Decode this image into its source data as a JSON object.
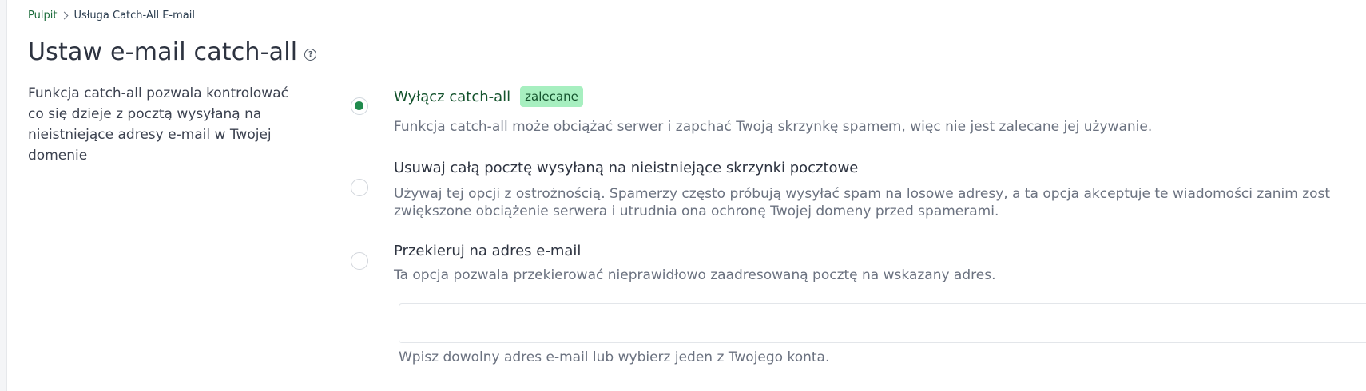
{
  "breadcrumb": {
    "home": "Pulpit",
    "current": "Usługa Catch-All E-mail"
  },
  "page": {
    "title": "Ustaw e-mail catch-all",
    "help_glyph": "?"
  },
  "description": "Funkcja catch-all pozwala kontrolować co się dzieje z pocztą wysyłaną na nieistniejące adresy e-mail w Twojej domenie",
  "options": [
    {
      "label": "Wyłącz catch-all",
      "badge": "zalecane",
      "description": "Funkcja catch-all może obciążać serwer i zapchać Twoją skrzynkę spamem, więc nie jest zalecane jej używanie.",
      "selected": true
    },
    {
      "label": "Usuwaj całą pocztę wysyłaną na nieistniejące skrzynki pocztowe",
      "description_line1": "Używaj tej opcji z ostrożnością. Spamerzy często próbują wysyłać spam na losowe adresy, a ta opcja akceptuje te wiadomości zanim zost",
      "description_line2": "zwiększone obciążenie serwera i utrudnia ona ochronę Twojej domeny przed spamerami.",
      "selected": false
    },
    {
      "label": "Przekieruj na adres e-mail",
      "description": "Ta opcja pozwala przekierować nieprawidłowo zaadresowaną pocztę na wskazany adres.",
      "selected": false
    }
  ],
  "forward": {
    "value": "",
    "placeholder": "",
    "hint": "Wpisz dowolny adres e-mail lub wybierz jeden z Twojego konta."
  },
  "colors": {
    "accent": "#1f8a4c",
    "badge_bg": "#a7efc0",
    "link": "#1a6b3a"
  }
}
